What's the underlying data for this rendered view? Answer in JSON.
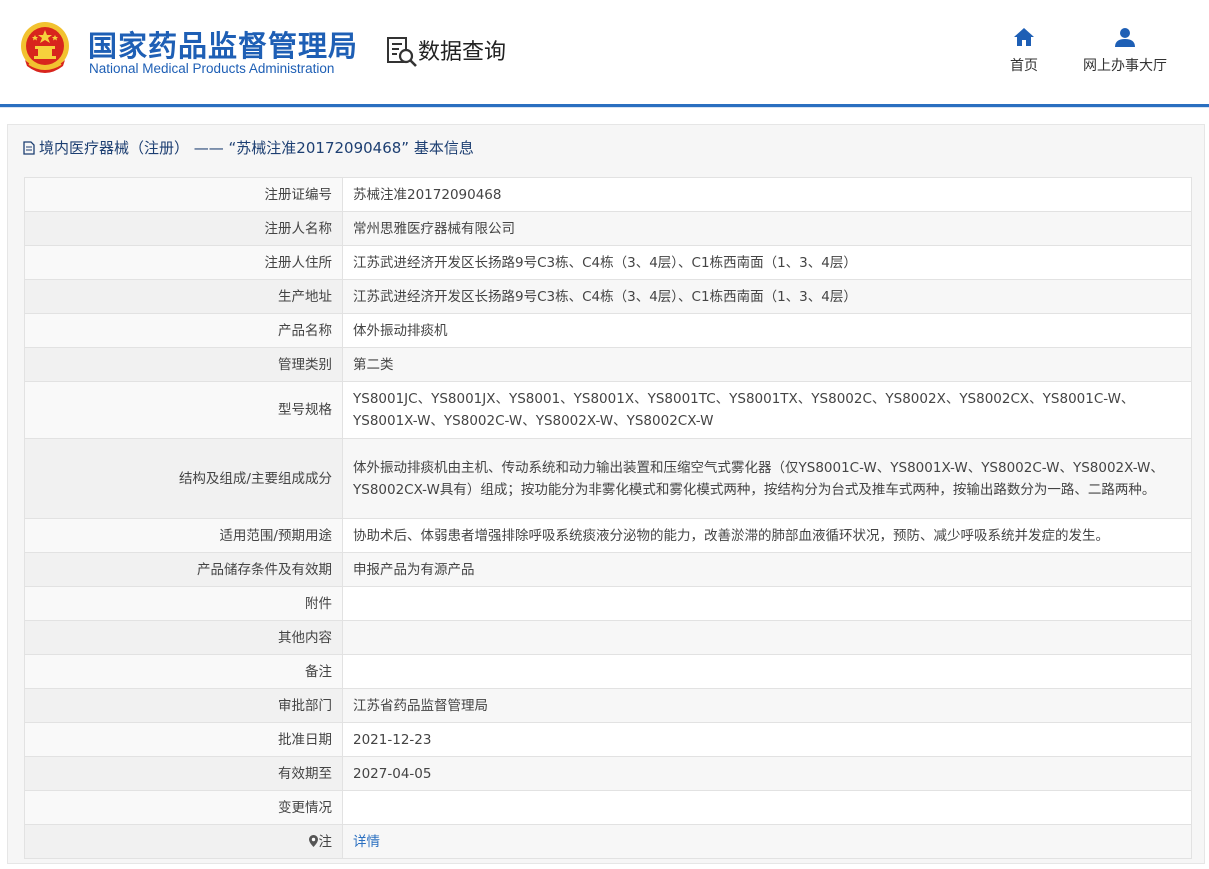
{
  "header": {
    "logo_cn": "国家药品监督管理局",
    "logo_en": "National Medical Products Administration",
    "section_title": "数据查询",
    "nav": {
      "home_label": "首页",
      "hall_label": "网上办事大厅"
    },
    "accent_color": "#1e5fb5"
  },
  "panel": {
    "title": "境内医疗器械（注册） —— “苏械注准20172090468” 基本信息"
  },
  "rows": [
    {
      "key": "注册证编号",
      "value": "苏械注准20172090468"
    },
    {
      "key": "注册人名称",
      "value": "常州思雅医疗器械有限公司"
    },
    {
      "key": "注册人住所",
      "value": "江苏武进经济开发区长扬路9号C3栋、C4栋（3、4层）、C1栋西南面（1、3、4层）"
    },
    {
      "key": "生产地址",
      "value": "江苏武进经济开发区长扬路9号C3栋、C4栋（3、4层）、C1栋西南面（1、3、4层）"
    },
    {
      "key": "产品名称",
      "value": "体外振动排痰机"
    },
    {
      "key": "管理类别",
      "value": "第二类"
    },
    {
      "key": "型号规格",
      "value": "YS8001JC、YS8001JX、YS8001、YS8001X、YS8001TC、YS8001TX、YS8002C、YS8002X、YS8002CX、YS8001C-W、YS8001X-W、YS8002C-W、YS8002X-W、YS8002CX-W"
    },
    {
      "key": "结构及组成/主要组成成分",
      "value": "体外振动排痰机由主机、传动系统和动力输出装置和压缩空气式雾化器（仅YS8001C-W、YS8001X-W、YS8002C-W、YS8002X-W、YS8002CX-W具有）组成；按功能分为非雾化模式和雾化模式两种，按结构分为台式及推车式两种，按输出路数分为一路、二路两种。"
    },
    {
      "key": "适用范围/预期用途",
      "value": "协助术后、体弱患者增强排除呼吸系统痰液分泌物的能力，改善淤滞的肺部血液循环状况，预防、减少呼吸系统并发症的发生。"
    },
    {
      "key": "产品储存条件及有效期",
      "value": "申报产品为有源产品"
    },
    {
      "key": "附件",
      "value": ""
    },
    {
      "key": "其他内容",
      "value": ""
    },
    {
      "key": "备注",
      "value": ""
    },
    {
      "key": "审批部门",
      "value": "江苏省药品监督管理局"
    },
    {
      "key": "批准日期",
      "value": "2021-12-23"
    },
    {
      "key": "有效期至",
      "value": "2027-04-05"
    },
    {
      "key": "变更情况",
      "value": ""
    },
    {
      "key": "注",
      "value": "详情"
    }
  ]
}
